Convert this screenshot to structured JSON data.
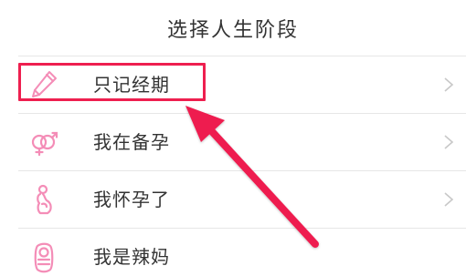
{
  "header": {
    "title": "选择人生阶段"
  },
  "options": [
    {
      "label": "只记经期",
      "icon": "pen-icon"
    },
    {
      "label": "我在备孕",
      "icon": "gender-symbols-icon"
    },
    {
      "label": "我怀孕了",
      "icon": "pregnant-woman-icon"
    },
    {
      "label": "我是辣妈",
      "icon": "baby-icon"
    }
  ],
  "colors": {
    "accent_pink": "#f48db7",
    "highlight_red": "#ee1f4f",
    "text": "#333333",
    "chevron": "#c8c8c8"
  }
}
